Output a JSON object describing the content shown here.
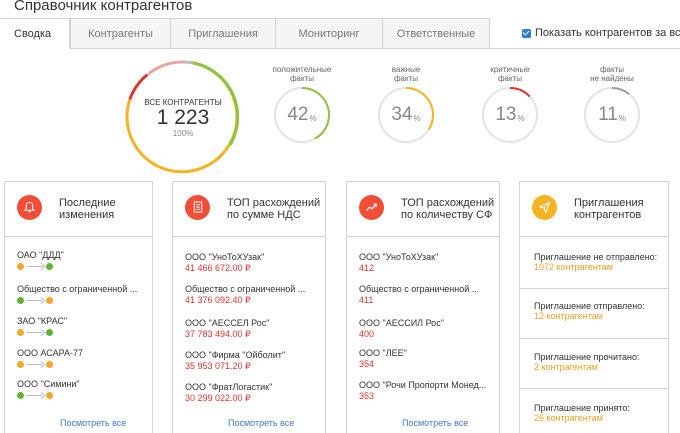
{
  "app": {
    "title": "Справочник контрагентов"
  },
  "tabs": [
    {
      "label": "Сводка",
      "active": true
    },
    {
      "label": "Контрагенты",
      "active": false
    },
    {
      "label": "Приглашения",
      "active": false
    },
    {
      "label": "Мониторинг",
      "active": false
    },
    {
      "label": "Ответственные",
      "active": false
    }
  ],
  "show_toggle": {
    "label": "Показать контрагентов за все пер",
    "checked": true
  },
  "summary": {
    "total": {
      "label": "ВСЕ КОНТРАГЕНТЫ",
      "value": "1 223",
      "percent": "100%"
    },
    "gauges": [
      {
        "title_line1": "положительные",
        "title_line2": "факты",
        "value": "42",
        "unit": "%",
        "fill": 0.42,
        "color": "#8cc63f"
      },
      {
        "title_line1": "важные",
        "title_line2": "факты",
        "value": "34",
        "unit": "%",
        "fill": 0.34,
        "color": "#f5b324"
      },
      {
        "title_line1": "критичные",
        "title_line2": "факты",
        "value": "13",
        "unit": "%",
        "fill": 0.13,
        "color": "#e2332a"
      },
      {
        "title_line1": "факты",
        "title_line2": "не найдены",
        "value": "11",
        "unit": "%",
        "fill": 0.11,
        "color": "#9e9e9e"
      }
    ]
  },
  "cards": {
    "changes": {
      "title_line1": "Последние",
      "title_line2": "изменения",
      "icon": "bell-icon",
      "icon_color": "#f04e37",
      "items": [
        {
          "name": "ОАО \"ДДД\"",
          "from": "#f5a623",
          "to": "#5bb535"
        },
        {
          "name": "Общество с ограниченной ...",
          "from": "#5bb535",
          "to": "#f5a623"
        },
        {
          "name": "ЗАО \"КРАС\"",
          "from": "#f5a623",
          "to": "#5bb535"
        },
        {
          "name": "ООО АСАРА-77",
          "from": "#f5a623",
          "to": "#f5a623"
        },
        {
          "name": "ООО \"Симини\"",
          "from": "#5bb535",
          "to": "#f5a623"
        }
      ],
      "link": "Посмотреть все"
    },
    "vat": {
      "title_line1": "ТОП расхождений",
      "title_line2": "по сумме НДС",
      "icon": "document-icon",
      "icon_color": "#f04e37",
      "items": [
        {
          "name": "ООО \"УноТоХУзак\"",
          "value": "41 466 672.00 ₽"
        },
        {
          "name": "Общество с ограниченной ...",
          "value": "41 376 092.40 ₽"
        },
        {
          "name": "ООО \"АЕССЕЛ Рос\"",
          "value": "37 783 494.00 ₽"
        },
        {
          "name": "ООО \"Фирма \"Ойболит\"",
          "value": "35 953 071.20 ₽"
        },
        {
          "name": "ООО \"ФратЛогастик\"",
          "value": "30 299 022.00 ₽"
        }
      ],
      "link": "Посмотреть все"
    },
    "sf": {
      "title_line1": "ТОП расхождений",
      "title_line2": "по количеству СФ",
      "icon": "trend-up-icon",
      "icon_color": "#f04e37",
      "items": [
        {
          "name": "ООО \"УноТоХУзак\"",
          "value": "412"
        },
        {
          "name": "Общество с ограниченной ...",
          "value": "411"
        },
        {
          "name": "ООО \"АЕССИЛ Рос\"",
          "value": "400"
        },
        {
          "name": "ООО \"ЛЕЕ\"",
          "value": "354"
        },
        {
          "name": "ООО \"Рочи Пропорти Монед...",
          "value": "353"
        }
      ],
      "link": "Посмотреть все"
    },
    "invites": {
      "title_line1": "Приглашения",
      "title_line2": "контрагентов",
      "icon": "paper-plane-icon",
      "icon_color": "#f5b324",
      "items": [
        {
          "title": "Приглашение не отправлено:",
          "count": "1072 контрагентам"
        },
        {
          "title": "Приглашение отправлено:",
          "count": "12 контрагентам"
        },
        {
          "title": "Приглашение прочитано:",
          "count": "2 контрагентам"
        },
        {
          "title": "Приглашение принято:",
          "count": "26 контрагентам"
        }
      ]
    }
  }
}
